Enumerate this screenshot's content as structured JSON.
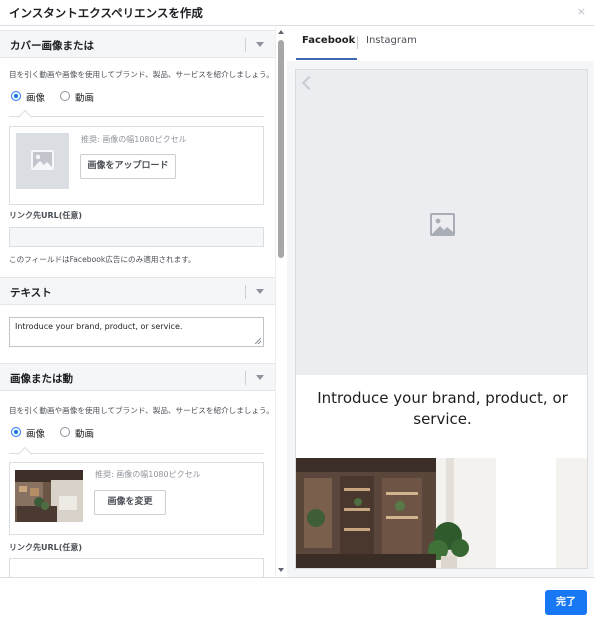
{
  "dialog": {
    "title": "インスタントエクスペリエンスを作成",
    "close_glyph": "×"
  },
  "cover_section": {
    "title": "カバー画像または",
    "help": "目を引く動画や画像を使用してブランド、製品、サービスを紹介しましょう。",
    "radio_image": "画像",
    "radio_video": "動画",
    "selected": "image",
    "recommendation": "推奨: 画像の幅1080ピクセル",
    "upload_button": "画像をアップロード",
    "url_label": "リンク先URL(任意)",
    "url_value": "",
    "note": "このフィールドはFacebook広告にのみ適用されます。"
  },
  "text_section": {
    "title": "テキスト",
    "value": "Introduce your brand, product, or service."
  },
  "image_section": {
    "title": "画像または動",
    "help": "目を引く動画や画像を使用してブランド、製品、サービスを紹介しましょう。",
    "radio_image": "画像",
    "radio_video": "動画",
    "selected": "image",
    "recommendation": "推奨: 画像の幅1080ピクセル",
    "change_button": "画像を変更",
    "url_label": "リンク先URL(任意)",
    "url_value": ""
  },
  "preview": {
    "tabs": [
      {
        "label": "Facebook",
        "active": true
      },
      {
        "label": "Instagram",
        "active": false
      }
    ],
    "text": "Introduce your brand, product, or service."
  },
  "footer": {
    "done_label": "完了"
  },
  "colors": {
    "accent": "#1877f2",
    "tab_underline": "#4267b2",
    "panel_bg": "#f5f6f7"
  },
  "icons": [
    "close-icon",
    "chevron-down-icon",
    "image-placeholder-icon",
    "back-chevron-icon"
  ]
}
